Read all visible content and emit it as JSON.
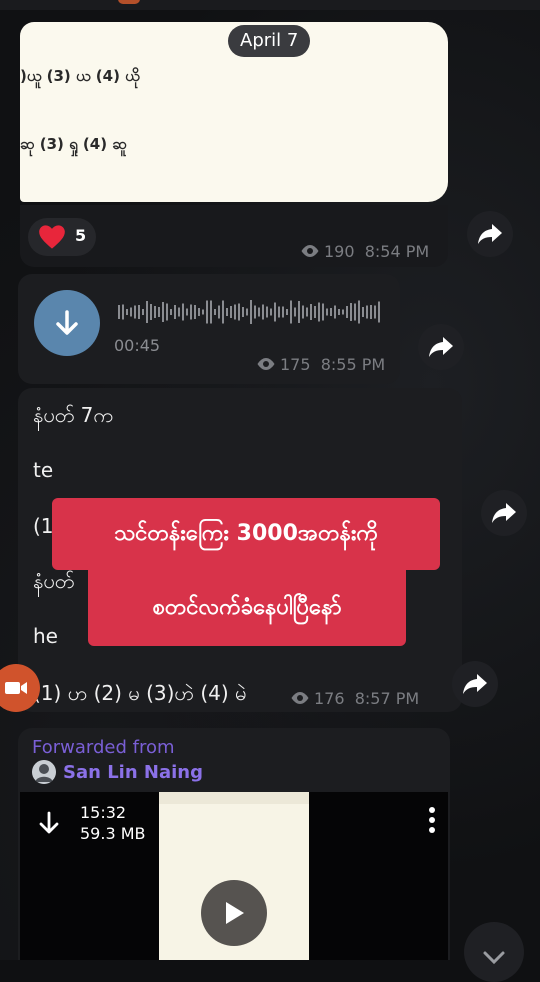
{
  "date_separator": "April 7",
  "image_message": {
    "line1": ")ယူ   (3) ယ    (4) ယို",
    "line2": "ဆု   (3) ရှု    (4) ဆူ",
    "reaction": {
      "emoji": "heart",
      "count": "5"
    },
    "views": "190",
    "time": "8:54 PM"
  },
  "voice_message": {
    "duration": "00:45",
    "views": "175",
    "time": "8:55 PM"
  },
  "text_message": {
    "line1": "နံပတ် 7က",
    "line2": "te",
    "line3": "(1",
    "line4": "နံပတ်",
    "line5": "he",
    "line6": "(1) ဟ (2) မ (3)ဟဲ (4) မဲ",
    "views": "176",
    "time": "8:57 PM"
  },
  "overlay_caption": {
    "line1": "သင်တန်းကြေး 3000အတန်းကို",
    "line2": "စတင်လက်ခံနေပါပြီနော်"
  },
  "forwarded_message": {
    "label": "Forwarded from",
    "sender": "San Lin Naing",
    "video_duration": "15:32",
    "video_size": "59.3 MB"
  },
  "colors": {
    "accent_blue": "#5a86ad",
    "caption_red": "#d8334a",
    "forward_purple": "#8b71e8",
    "heart_red": "#e8263b"
  }
}
